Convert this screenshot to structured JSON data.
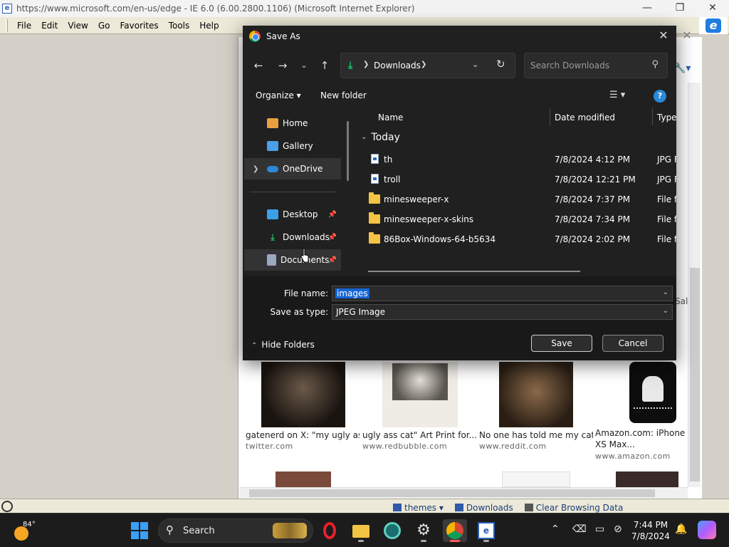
{
  "ie": {
    "title": "https://www.microsoft.com/en-us/edge - IE 6.0 (6.00.2800.1106) (Microsoft Internet Explorer)",
    "menu": [
      "File",
      "Edit",
      "View",
      "Go",
      "Favorites",
      "Tools",
      "Help"
    ],
    "caption": {
      "minimize": "—",
      "maximize": "❐",
      "close": "✕"
    },
    "partial_text": "Sal",
    "results": [
      {
        "title": "gatenerd on X: \"my ugly ass...",
        "url": "twitter.com"
      },
      {
        "title": "ugly ass cat\" Art Print for...",
        "url": "www.redbubble.com"
      },
      {
        "title": "No one has told me my cat...",
        "url": "www.reddit.com"
      },
      {
        "title": "Amazon.com: iPhone XS Max...",
        "url": "www.amazon.com"
      }
    ],
    "statusbar": [
      "themes",
      "Downloads",
      "Clear Browsing Data"
    ]
  },
  "dialog": {
    "title": "Save As",
    "address": {
      "location": "Downloads"
    },
    "search": {
      "placeholder": "Search Downloads"
    },
    "toolbar": {
      "organize": "Organize",
      "new_folder": "New folder"
    },
    "nav": {
      "items": [
        {
          "label": "Home",
          "icon": "home-icon",
          "color": "#e8a040"
        },
        {
          "label": "Gallery",
          "icon": "gallery-icon",
          "color": "#4aa0e8"
        },
        {
          "label": "OneDrive",
          "icon": "onedrive-icon",
          "color": "#2b88d8"
        },
        {
          "label": "Desktop",
          "icon": "desktop-icon",
          "color": "#3aa0e8"
        },
        {
          "label": "Downloads",
          "icon": "download-icon",
          "color": "#21c165"
        },
        {
          "label": "Documents",
          "icon": "document-icon",
          "color": "#9aa8c0"
        }
      ]
    },
    "columns": [
      "Name",
      "Date modified",
      "Type"
    ],
    "group": "Today",
    "files": [
      {
        "name": "th",
        "date": "7/8/2024 4:12 PM",
        "type": "JPG F",
        "kind": "jpg"
      },
      {
        "name": "troll",
        "date": "7/8/2024 12:21 PM",
        "type": "JPG F",
        "kind": "jpg"
      },
      {
        "name": "minesweeper-x",
        "date": "7/8/2024 7:37 PM",
        "type": "File fo",
        "kind": "folder"
      },
      {
        "name": "minesweeper-x-skins",
        "date": "7/8/2024 7:34 PM",
        "type": "File fo",
        "kind": "folder"
      },
      {
        "name": "86Box-Windows-64-b5634",
        "date": "7/8/2024 2:02 PM",
        "type": "File fo",
        "kind": "folder"
      }
    ],
    "file_name": {
      "label": "File name:",
      "value": "images"
    },
    "save_type": {
      "label": "Save as type:",
      "value": "JPEG Image"
    },
    "hide_folders": "Hide Folders",
    "save": "Save",
    "cancel": "Cancel"
  },
  "taskbar": {
    "weather": "84°",
    "search": "Search",
    "time": "7:44 PM",
    "date": "7/8/2024"
  }
}
